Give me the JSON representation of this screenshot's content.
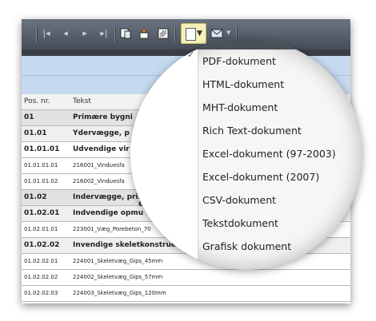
{
  "toolbar": {
    "nav_buttons": [
      "first-page-icon",
      "previous-page-icon",
      "next-page-icon",
      "last-page-icon"
    ],
    "tool_icons": [
      "page-setup-icon",
      "highlight-icon",
      "watermark-icon"
    ],
    "export_icon": "export-document-icon",
    "email_icon": "email-icon"
  },
  "report": {
    "columns": {
      "pos": "Pos. nr.",
      "text": "Tekst"
    },
    "rows": [
      {
        "pos": "01",
        "text": "Primære bygni"
      },
      {
        "pos": "01.01",
        "text": "Ydervægge, p"
      },
      {
        "pos": "01.01.01",
        "text": "Udvendige vir"
      },
      {
        "pos": "01.01.01.01",
        "text": "216001_Vinduesfa"
      },
      {
        "pos": "01.01.01.02",
        "text": "216002_Vinduesfa"
      },
      {
        "pos": "01.02",
        "text": "Indervægge, primer"
      },
      {
        "pos": "01.02.01",
        "text": "Indvendige opmu"
      },
      {
        "pos": "01.02.01.01",
        "text": "223001_Væg_Porebeton_70"
      },
      {
        "pos": "01.02.02",
        "text": "Invendige skeletkonstrue"
      },
      {
        "pos": "01.02.02.01",
        "text": "224001_Skeletvæg_Gips_45mm"
      },
      {
        "pos": "01.02.02.02",
        "text": "224002_Skeletvæg_Gips_57mm"
      },
      {
        "pos": "01.02.02.03",
        "text": "224003_Skeletvæg_Gips_120mm"
      }
    ],
    "fragment": "dele"
  },
  "export_menu": {
    "items": [
      "PDF-dokument",
      "HTML-dokument",
      "MHT-dokument",
      "Rich Text-dokument",
      "Excel-dokument (97-2003)",
      "Excel-dokument (2007)",
      "CSV-dokument",
      "Tekstdokument",
      "Grafisk dokument"
    ]
  },
  "colors": {
    "toolbar": "#4f5861",
    "header_band": "#c5d9ef",
    "export_highlight": "#f4f0b8"
  }
}
